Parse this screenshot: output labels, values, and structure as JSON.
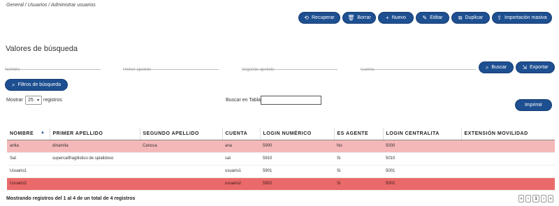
{
  "breadcrumb": "General / Usuarios / Administrar usuarios",
  "toolbar": {
    "recuperar": "Recuperar",
    "borrar": "Borrar",
    "nuevo": "Nuevo",
    "editar": "Editar",
    "duplicar": "Duplicar",
    "importacion": "Importación masiva"
  },
  "search": {
    "title": "Valores de búsqueda",
    "nombre_placeholder": "Nombre",
    "apellido1_placeholder": "Primer apellido",
    "apellido2_placeholder": "Segundo apellido",
    "cuenta_placeholder": "Cuenta",
    "buscar": "Buscar",
    "exportar": "Exportar",
    "filtros": "Filtros de búsqueda"
  },
  "imprimir": "Imprimir",
  "table_controls": {
    "mostrar": "Mostrar",
    "page_size": "25",
    "registros": "registros",
    "buscar_tabla": "Buscar en Tabla:"
  },
  "table": {
    "headers": [
      "NOMBRE",
      "PRIMER APELLIDO",
      "SEGUNDO APELLIDO",
      "CUENTA",
      "LOGIN NUMÉRICO",
      "ES AGENTE",
      "LOGIN CENTRALITA",
      "EXTENSIÓN MOVILIDAD"
    ],
    "rows": [
      [
        "anita",
        "dinamita",
        "Canosa",
        "ana",
        "5900",
        "No",
        "5000",
        ""
      ],
      [
        "Sat",
        "supercalifragilistico de spialidoso",
        "",
        "sat",
        "5910",
        "Si",
        "5010",
        ""
      ],
      [
        "Usuario1",
        "",
        "",
        "usuario1",
        "5901",
        "Si",
        "5001",
        ""
      ],
      [
        "Usuario2",
        "",
        "",
        "usuario2",
        "5902",
        "Si",
        "5002",
        ""
      ]
    ]
  },
  "footer": "Mostrando registros del 1 al 4 de un total de 4 registros",
  "pager": {
    "first": "«",
    "prev": "‹",
    "page": "1",
    "next": "›",
    "last": "»"
  },
  "colors": {
    "primary": "#1d4f91",
    "row_pink": "#f5b8b8",
    "row_red": "#ea6a6a"
  }
}
